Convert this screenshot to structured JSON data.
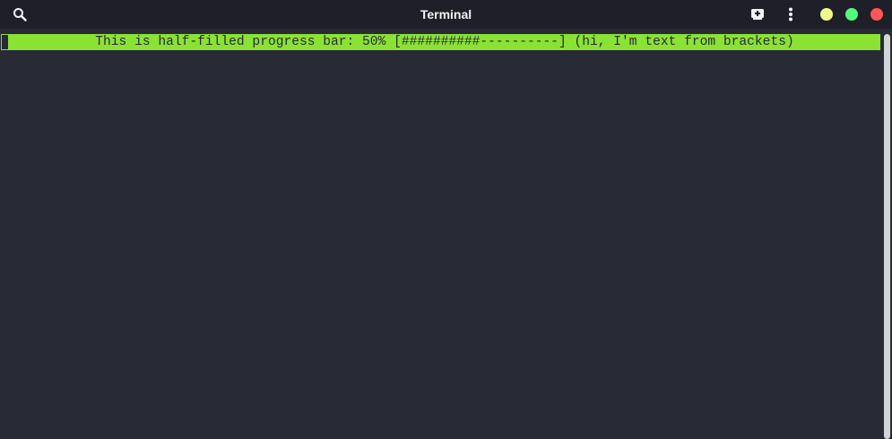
{
  "window": {
    "title": "Terminal"
  },
  "colors": {
    "titlebar_bg": "#1e1f29",
    "terminal_bg": "#282a36",
    "progress_fill": "#8ae234",
    "minimize": "#f1fa8c",
    "maximize": "#50fa7b",
    "close": "#ff5555"
  },
  "icons": {
    "search": "search-icon",
    "new_tab": "new-tab-icon",
    "menu": "kebab-menu-icon"
  },
  "terminal": {
    "line": "This is half-filled progress bar: 50% [##########----------] (hi, I'm text from brackets)",
    "progress_percent": 50
  }
}
